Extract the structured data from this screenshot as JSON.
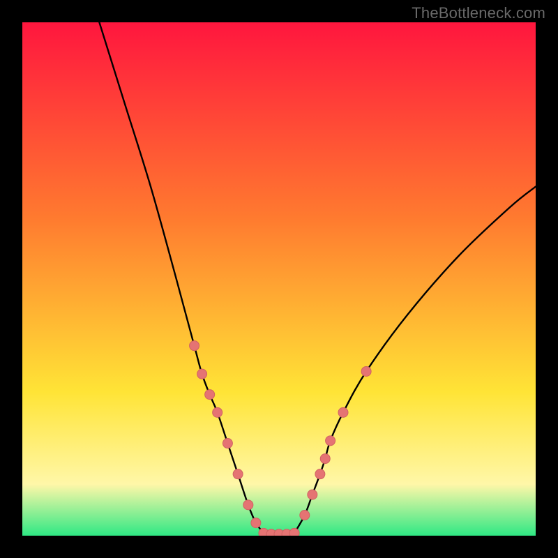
{
  "watermark": {
    "text": "TheBottleneck.com"
  },
  "colors": {
    "bg": "#000000",
    "curve": "#000000",
    "marker_fill": "#e57373",
    "marker_stroke": "#d06262",
    "grad_top": "#ff163e",
    "grad_mid1": "#ff7a2f",
    "grad_mid2": "#ffe436",
    "grad_mid3": "#fff7a8",
    "grad_bottom": "#2fe884"
  },
  "chart_data": {
    "type": "line",
    "title": "",
    "xlabel": "",
    "ylabel": "",
    "xlim": [
      0,
      100
    ],
    "ylim": [
      0,
      100
    ],
    "legend": false,
    "grid": false,
    "note": "Left branch (monotone decreasing) and right branch (monotone increasing) meeting in a flat minimum near x≈47–53. Values are estimated from pixel positions; axes unlabeled in source.",
    "series": [
      {
        "name": "left_branch",
        "x": [
          15.0,
          20.0,
          25.0,
          30.0,
          33.5,
          35.0,
          36.5,
          38.0,
          40.0,
          42.0,
          44.0,
          45.5,
          47.0
        ],
        "y": [
          100.0,
          84.0,
          68.0,
          50.0,
          37.0,
          31.5,
          27.5,
          24.0,
          18.0,
          12.0,
          6.0,
          2.5,
          0.5
        ]
      },
      {
        "name": "right_branch",
        "x": [
          53.0,
          55.0,
          56.5,
          58.0,
          59.0,
          60.0,
          62.5,
          67.0,
          75.0,
          85.0,
          95.0,
          100.0
        ],
        "y": [
          0.5,
          4.0,
          8.0,
          12.0,
          15.0,
          18.5,
          24.0,
          32.0,
          43.0,
          54.5,
          64.0,
          68.0
        ]
      },
      {
        "name": "plateau_min",
        "x": [
          47.0,
          48.5,
          50.0,
          51.5,
          53.0
        ],
        "y": [
          0.5,
          0.3,
          0.3,
          0.3,
          0.5
        ]
      }
    ],
    "markers": {
      "name": "highlighted_points",
      "shape": "circle",
      "color": "#e57373",
      "points": [
        {
          "x": 33.5,
          "y": 37.0
        },
        {
          "x": 35.0,
          "y": 31.5
        },
        {
          "x": 36.5,
          "y": 27.5
        },
        {
          "x": 38.0,
          "y": 24.0
        },
        {
          "x": 40.0,
          "y": 18.0
        },
        {
          "x": 42.0,
          "y": 12.0
        },
        {
          "x": 44.0,
          "y": 6.0
        },
        {
          "x": 45.5,
          "y": 2.5
        },
        {
          "x": 47.0,
          "y": 0.5
        },
        {
          "x": 48.5,
          "y": 0.3
        },
        {
          "x": 50.0,
          "y": 0.3
        },
        {
          "x": 51.5,
          "y": 0.3
        },
        {
          "x": 53.0,
          "y": 0.5
        },
        {
          "x": 55.0,
          "y": 4.0
        },
        {
          "x": 56.5,
          "y": 8.0
        },
        {
          "x": 58.0,
          "y": 12.0
        },
        {
          "x": 59.0,
          "y": 15.0
        },
        {
          "x": 60.0,
          "y": 18.5
        },
        {
          "x": 62.5,
          "y": 24.0
        },
        {
          "x": 67.0,
          "y": 32.0
        }
      ]
    }
  }
}
